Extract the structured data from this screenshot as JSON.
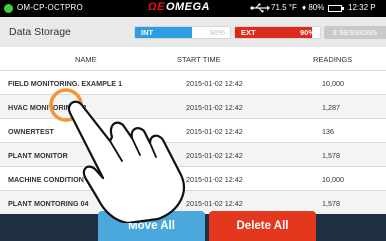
{
  "status_bar": {
    "device_name": "OM-CP-OCTPRO",
    "brand": "OMEGA",
    "brand_symbol": "ΩE",
    "temperature": "71.5 °F",
    "humidity": "80%",
    "humidity_icon": "droplet",
    "time": "12:32 P",
    "status_color": "#3bd13b"
  },
  "header": {
    "title": "Data Storage",
    "internal": {
      "label": "INT",
      "percent_text": "60%",
      "fill": 0.6,
      "color": "#2f9ee0"
    },
    "external": {
      "label": "EXT",
      "percent_text": "90%",
      "fill": 0.9,
      "color": "#dd2a1c"
    },
    "sessions": "8 SESSIONS"
  },
  "table": {
    "columns": [
      "NAME",
      "START TIME",
      "READINGS"
    ],
    "rows": [
      {
        "name": "FIELD MONITORING. EXAMPLE 1",
        "start": "2015-01-02 12:42",
        "readings": "10,000"
      },
      {
        "name": "HVAC MONITORING 02",
        "start": "2015-01-02 12:42",
        "readings": "1,287"
      },
      {
        "name": "OWNERTEST",
        "start": "2015-01-02 12:42",
        "readings": "136"
      },
      {
        "name": "PLANT MONITOR",
        "start": "2015-01-02 12:42",
        "readings": "1,578"
      },
      {
        "name": "MACHINE CONDITION",
        "start": "2015-01-02 12:42",
        "readings": "10,000"
      },
      {
        "name": "PLANT MONTORING 04",
        "start": "2015-01-02 12:42",
        "readings": "1,578"
      }
    ]
  },
  "actions": {
    "move_all": "Move All",
    "delete_all": "Delete All"
  }
}
